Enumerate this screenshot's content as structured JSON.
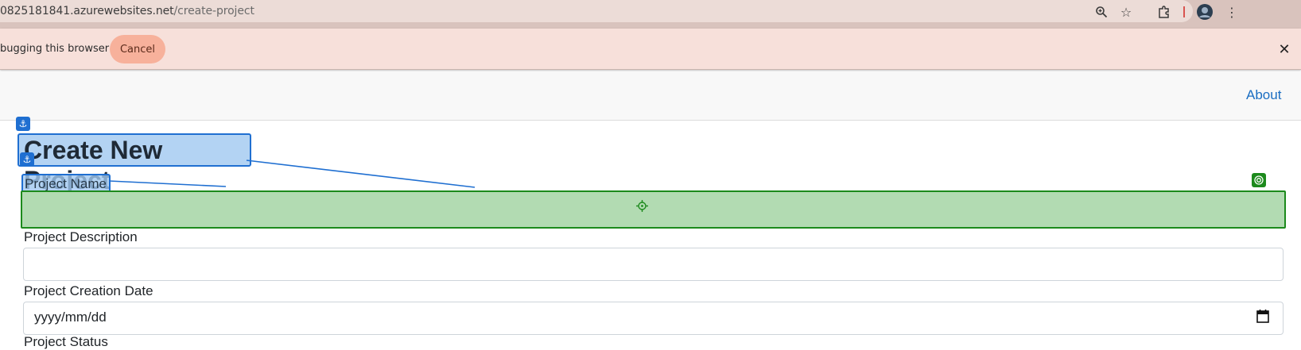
{
  "browser": {
    "url_host": "0825181841.azurewebsites.net",
    "url_path": "/create-project",
    "icons": [
      "zoom-icon",
      "star-icon",
      "extensions-icon",
      "profile-avatar",
      "more-menu-icon"
    ]
  },
  "infobar": {
    "message": "bugging this browser",
    "cancel_label": "Cancel",
    "close_glyph": "✕"
  },
  "navbar": {
    "about_label": "About"
  },
  "form": {
    "title": "Create New Project",
    "name_label": "Project Name",
    "name_value": "",
    "description_label": "Project Description",
    "description_value": "",
    "date_label": "Project Creation Date",
    "date_placeholder": "yyyy/mm/dd",
    "status_label": "Project Status"
  },
  "colors": {
    "link": "#1b6ec2",
    "anchor_overlay": "#1f6fd1",
    "target_overlay": "#1c8a1c",
    "infobar_bg": "#f7e0da",
    "cancel_bg": "#f7b19b"
  }
}
